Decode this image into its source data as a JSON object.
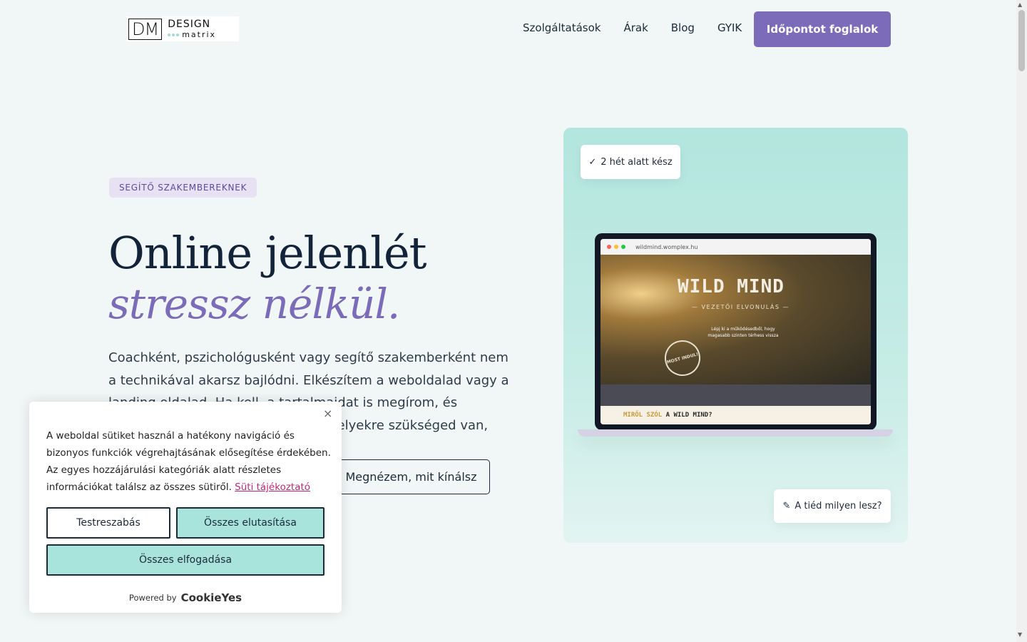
{
  "header": {
    "logo_mark": "DM",
    "logo_word1": "DESIGN",
    "logo_word2": "matrix",
    "nav": [
      "Szolgáltatások",
      "Árak",
      "Blog",
      "GYIK"
    ],
    "cta": "Időpontot foglalok"
  },
  "hero": {
    "badge": "SEGÍTŐ SZAKEMBEREKNEK",
    "title_line1": "Online jelenlét",
    "title_line2": "stressz nélkül.",
    "lead": "Coachként, pszichológusként vagy segítő szakemberként nem a technikával akarsz bajlódni. Elkészítem a weboldalad vagy a landing oldalad. Ha kell, a tartalmaidat is megírom, és beállítom azokat az eszközöket, amelyekre szükséged van, hogy neked.",
    "secondary_button": "Megnézem, mit kínálsz",
    "pill_top": "2 hét alatt kész",
    "pill_bottom": "A tiéd milyen lesz?",
    "check_glyph": "✓",
    "pencil_glyph": "✎"
  },
  "mockup": {
    "url": "wildmind.womplex.hu",
    "site_title": "WILD MIND",
    "site_subtitle": "— VEZETŐI ELVONULÁS —",
    "site_tagline": "Lépj ki a működésedből, hogy magasabb szinten térhess vissza",
    "stamp": "MOST INDUL!",
    "bottom_text_a": "MIRŐL SZÓL",
    "bottom_text_b": "A WILD MIND?"
  },
  "cookie": {
    "text": "A weboldal sütiket használ a hatékony navigáció és bizonyos funkciók végrehajtásának elősegítése érdekében. Az egyes hozzájárulási kategóriák alatt részletes információkat találsz az összes sütiről.",
    "link": "Süti tájékoztató",
    "customize": "Testreszabás",
    "reject": "Összes elutasítása",
    "accept": "Összes elfogadása",
    "powered_by": "Powered by",
    "brand": "CookieYes",
    "close": "×"
  },
  "colors": {
    "accent": "#7b6bb8",
    "mint": "#a8e4dc",
    "background": "#f1f7f6"
  }
}
